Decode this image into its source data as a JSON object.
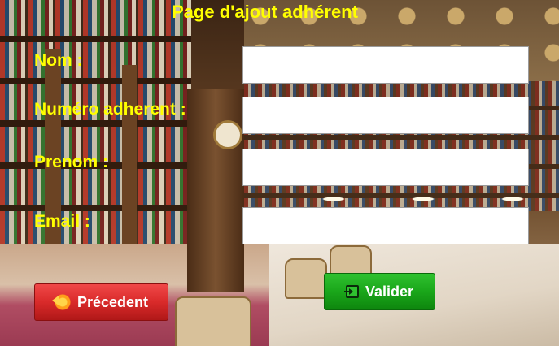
{
  "page": {
    "title": "Page d'ajout adhérent"
  },
  "form": {
    "nom_label": "Nom :",
    "numero_label": "Numéro adherent :",
    "prenom_label": "Prenom  :",
    "email_label": "Email :",
    "nom_value": "",
    "numero_value": "",
    "prenom_value": "",
    "email_value": ""
  },
  "buttons": {
    "previous_label": "Précedent",
    "previous_icon": "undo-arrow-icon",
    "validate_label": "Valider",
    "validate_icon": "login-icon"
  },
  "colors": {
    "label_color": "#ffff00",
    "previous_button": "#d92a2a",
    "validate_button": "#1aa61a"
  }
}
